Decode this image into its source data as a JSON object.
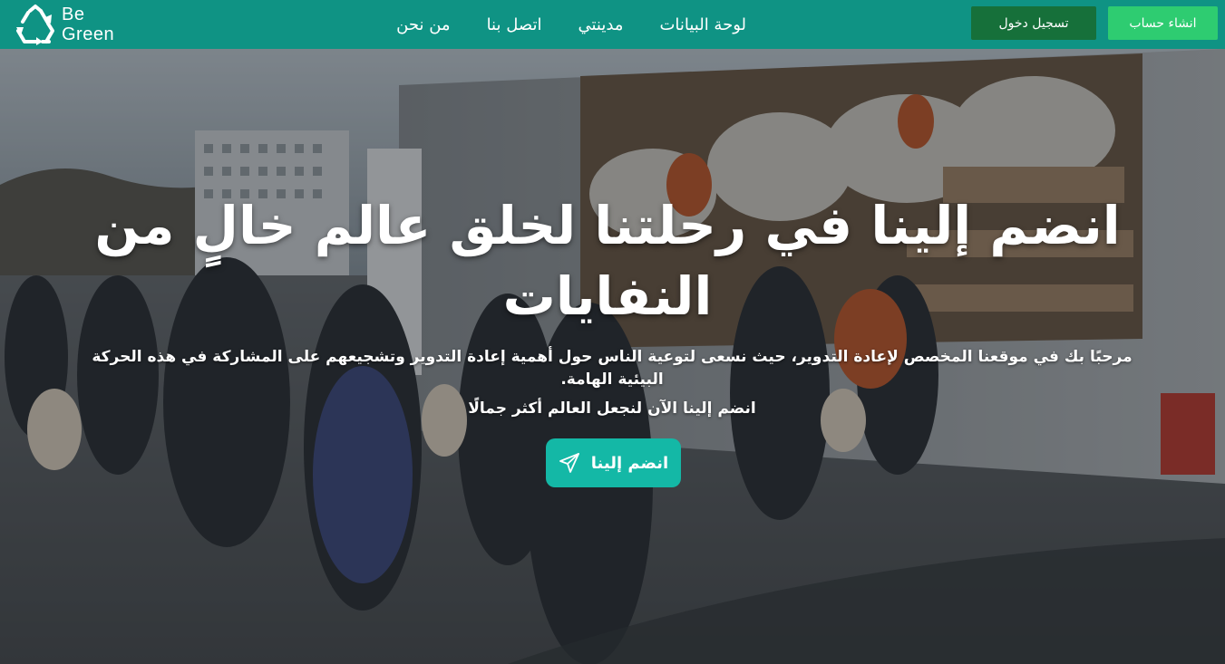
{
  "brand": {
    "line1": "Be",
    "line2": "Green",
    "icon": "recycle-icon"
  },
  "nav": {
    "links": [
      {
        "label": "لوحة البيانات"
      },
      {
        "label": "مدينتي"
      },
      {
        "label": "اتصل بنا"
      },
      {
        "label": "من نحن"
      }
    ],
    "signup_label": "انشاء حساب",
    "login_label": "تسجيل دخول"
  },
  "hero": {
    "title": "انضم إلينا في رحلتنا لخلق عالم خالٍ من النفايات",
    "description": "مرحبًا بك في موقعنا المخصص لإعادة التدوير،  حيث نسعى لتوعية الناس حول أهمية إعادة التدوير وتشجيعهم على المشاركة في هذه الحركة البيئية الهامة.",
    "subtitle": "انضم إلينا الآن لنجعل العالم أكثر جمالًا",
    "cta_label": "انضم إلينا",
    "cta_icon": "send-icon"
  },
  "colors": {
    "navbar": "#0f9384",
    "signup_button": "#2ecc71",
    "login_button": "#16703a",
    "cta_button": "#14b8a6"
  }
}
